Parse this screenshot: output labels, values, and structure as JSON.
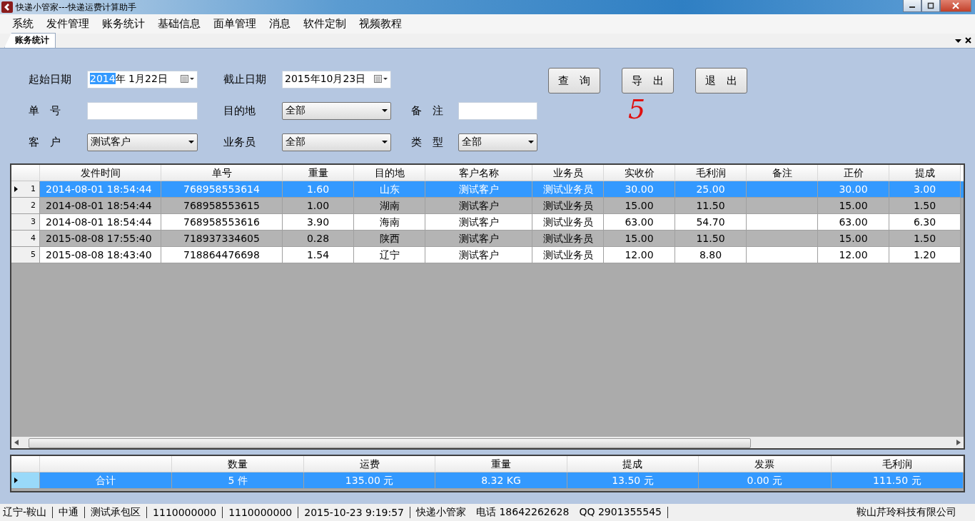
{
  "window": {
    "title": "快递小管家---快递运费计算助手"
  },
  "menu": [
    "系统",
    "发件管理",
    "账务统计",
    "基础信息",
    "面单管理",
    "消息",
    "软件定制",
    "视频教程"
  ],
  "tabs": [
    {
      "label": "账务统计",
      "selected": true
    }
  ],
  "form": {
    "rows": [
      [
        {
          "label": "起始日期",
          "kind": "date",
          "selected_part": "2014",
          "value": "年 1月22日"
        },
        {
          "label": "截止日期",
          "kind": "date",
          "value": "2015年10月23日"
        }
      ],
      [
        {
          "label": "单　号",
          "kind": "text"
        },
        {
          "label": "目的地",
          "kind": "select",
          "value": "全部"
        },
        {
          "label": "备　注",
          "kind": "text"
        }
      ],
      [
        {
          "label": "客　户",
          "kind": "select",
          "value": "测试客户"
        },
        {
          "label": "业务员",
          "kind": "select",
          "value": "全部"
        },
        {
          "label": "类　型",
          "kind": "select",
          "value": "全部"
        }
      ]
    ],
    "buttons": [
      "查　询",
      "导　出",
      "退　出"
    ],
    "record_count": "5"
  },
  "table": {
    "columns": [
      "发件时间",
      "单号",
      "重量",
      "目的地",
      "客户名称",
      "业务员",
      "实收价",
      "毛利润",
      "备注",
      "正价",
      "提成"
    ],
    "rows": [
      {
        "number": "1",
        "selected": true,
        "cells": [
          "2014-08-01 18:54:44",
          "768958553614",
          "1.60",
          "山东",
          "测试客户",
          "测试业务员",
          "30.00",
          "25.00",
          "",
          "30.00",
          "3.00"
        ]
      },
      {
        "number": "2",
        "selected": false,
        "cells": [
          "2014-08-01 18:54:44",
          "768958553615",
          "1.00",
          "湖南",
          "测试客户",
          "测试业务员",
          "15.00",
          "11.50",
          "",
          "15.00",
          "1.50"
        ]
      },
      {
        "number": "3",
        "selected": false,
        "cells": [
          "2014-08-01 18:54:44",
          "768958553616",
          "3.90",
          "海南",
          "测试客户",
          "测试业务员",
          "63.00",
          "54.70",
          "",
          "63.00",
          "6.30"
        ]
      },
      {
        "number": "4",
        "selected": false,
        "cells": [
          "2015-08-08 17:55:40",
          "718937334605",
          "0.28",
          "陕西",
          "测试客户",
          "测试业务员",
          "15.00",
          "11.50",
          "",
          "15.00",
          "1.50"
        ]
      },
      {
        "number": "5",
        "selected": false,
        "cells": [
          "2015-08-08 18:43:40",
          "718864476698",
          "1.54",
          "辽宁",
          "测试客户",
          "测试业务员",
          "12.00",
          "8.80",
          "",
          "12.00",
          "1.20"
        ]
      }
    ]
  },
  "summary": {
    "columns": [
      "",
      "数量",
      "运费",
      "重量",
      "提成",
      "发票",
      "毛利润"
    ],
    "rows": [
      {
        "selected": true,
        "cells": [
          "合计",
          "5 件",
          "135.00 元",
          "8.32 KG",
          "13.50 元",
          "0.00 元",
          "111.50 元"
        ]
      }
    ]
  },
  "status_bar": {
    "segments": [
      "辽宁-鞍山",
      "中通",
      "测试承包区",
      "1110000000",
      "1110000000",
      "2015-10-23 9:19:57",
      "快递小管家　电话 18642262628　QQ 2901355545"
    ],
    "company": "鞍山芹玲科技有限公司"
  }
}
